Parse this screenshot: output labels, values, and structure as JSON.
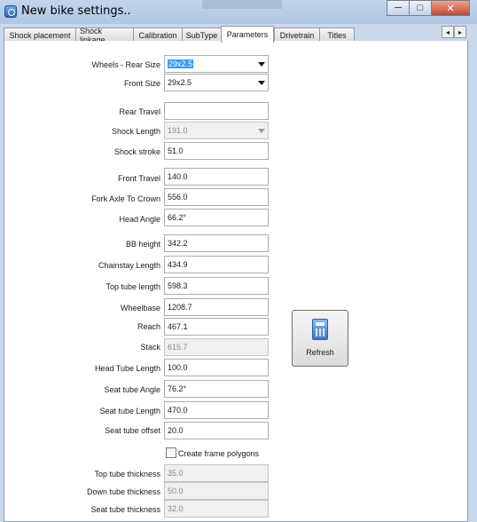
{
  "window": {
    "title": "New bike settings..",
    "controls": {
      "minimize": "─",
      "maximize": "□",
      "close": "✕"
    }
  },
  "tabs": [
    {
      "label": "Shock placement"
    },
    {
      "label": "Shock linkage"
    },
    {
      "label": "Calibration"
    },
    {
      "label": "SubType"
    },
    {
      "label": "Parameters",
      "active": true
    },
    {
      "label": "Drivetrain"
    },
    {
      "label": "Titles"
    }
  ],
  "tab_scroll": {
    "left": "◂",
    "right": "▸"
  },
  "wheels": {
    "label": "Wheels -   Rear Size",
    "rear_size": "29x2.5",
    "front_label": "Front Size",
    "front_size": "29x2.5"
  },
  "fields": {
    "rear_travel": {
      "label": "Rear Travel",
      "value": ""
    },
    "shock_length": {
      "label": "Shock Length",
      "value": "191.0"
    },
    "shock_stroke": {
      "label": "Shock stroke",
      "value": "51.0"
    },
    "front_travel": {
      "label": "Front Travel",
      "value": "140.0"
    },
    "fork_axle": {
      "label": "Fork Axle To Crown",
      "value": "556.0"
    },
    "head_angle": {
      "label": "Head Angle",
      "value": "66.2°"
    },
    "bb_height": {
      "label": "BB height",
      "value": "342.2"
    },
    "chainstay": {
      "label": "Chainstay Length",
      "value": "434.9"
    },
    "top_tube_length": {
      "label": "Top tube length",
      "value": "598.3"
    },
    "wheelbase": {
      "label": "Wheelbase",
      "value": "1208.7"
    },
    "reach": {
      "label": "Reach",
      "value": "467.1"
    },
    "stack": {
      "label": "Stack",
      "value": "615.7"
    },
    "head_tube_length": {
      "label": "Head Tube Length",
      "value": "100.0"
    },
    "seat_tube_angle": {
      "label": "Seat tube Angle",
      "value": "76.2°"
    },
    "seat_tube_length": {
      "label": "Seat tube Length",
      "value": "470.0"
    },
    "seat_tube_offset": {
      "label": "Seat tube offset",
      "value": "20.0"
    },
    "top_tube_thick": {
      "label": "Top tube thickness",
      "value": "35.0"
    },
    "down_tube_thick": {
      "label": "Down tube thickness",
      "value": "50.0"
    },
    "seat_tube_thick": {
      "label": "Seat tube thickness",
      "value": "32.0"
    }
  },
  "create_polygons": {
    "label": "Create frame polygons",
    "checked": false
  },
  "refresh_button": {
    "label": "Refresh",
    "icon": "calculator-icon"
  }
}
